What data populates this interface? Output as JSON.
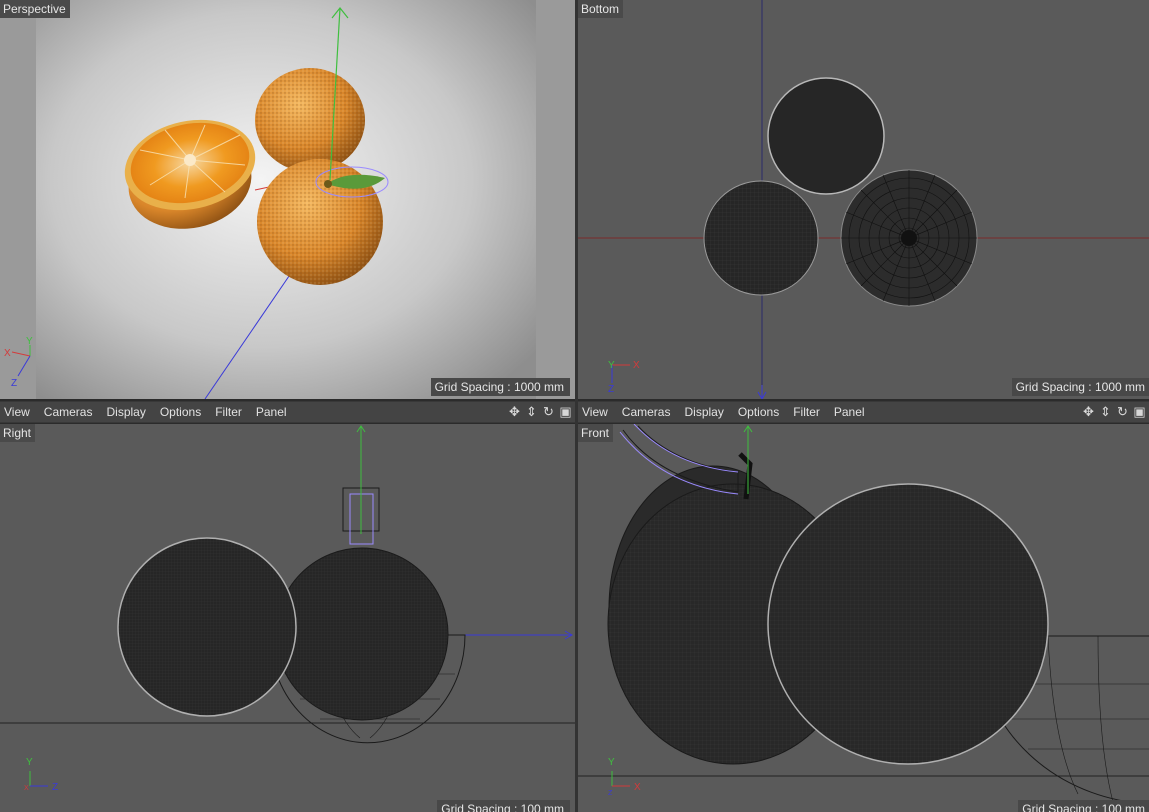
{
  "viewports": {
    "perspective": {
      "label": "Perspective",
      "grid": "Grid Spacing : 1000 mm"
    },
    "bottom": {
      "label": "Bottom",
      "grid": "Grid Spacing : 1000 mm"
    },
    "right": {
      "label": "Right",
      "grid": "Grid Spacing : 100 mm"
    },
    "front": {
      "label": "Front",
      "grid": "Grid Spacing : 100 mm"
    }
  },
  "menu": {
    "view": "View",
    "cameras": "Cameras",
    "display": "Display",
    "options": "Options",
    "filter": "Filter",
    "panel": "Panel"
  },
  "axes": {
    "x": "X",
    "y": "Y",
    "z": "Z"
  },
  "icons": [
    "move-view-icon",
    "dolly-view-icon",
    "rotate-view-icon",
    "toggle-panel-icon"
  ],
  "colors": {
    "x_axis": "#d33b3b",
    "y_axis": "#3fbf3f",
    "z_axis": "#3a3ad8",
    "orange": "#e08a24",
    "selection": "#9a8aff"
  }
}
